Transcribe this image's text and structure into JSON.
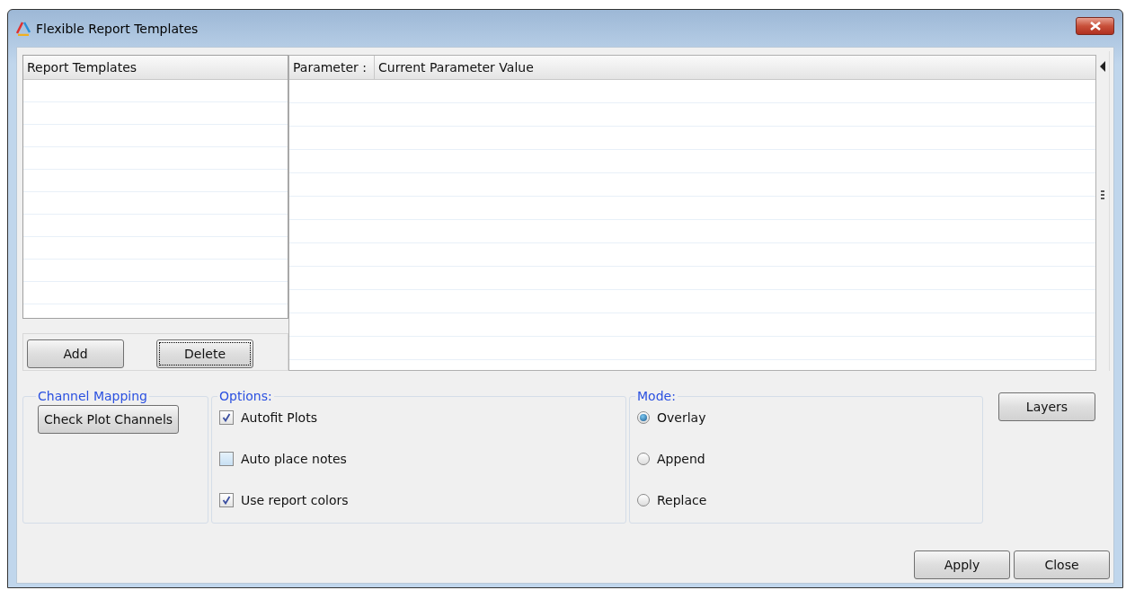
{
  "window": {
    "title": "Flexible Report Templates"
  },
  "templates_list": {
    "header": "Report Templates"
  },
  "template_buttons": [
    {
      "label": "Add",
      "focused": false
    },
    {
      "label": "Delete",
      "focused": true
    }
  ],
  "parameter_table": {
    "columns": [
      "Parameter :",
      "Current Parameter Value"
    ]
  },
  "channel_mapping": {
    "title": "Channel Mapping",
    "button": "Check Plot Channels"
  },
  "options": {
    "title": "Options:",
    "items": [
      {
        "label": "Autofit Plots",
        "checked": true
      },
      {
        "label": "Auto place notes",
        "checked": false
      },
      {
        "label": "Use report colors",
        "checked": true
      }
    ]
  },
  "mode": {
    "title": "Mode:",
    "items": [
      {
        "label": "Overlay",
        "selected": true
      },
      {
        "label": "Append",
        "selected": false
      },
      {
        "label": "Replace",
        "selected": false
      }
    ]
  },
  "layers_button": "Layers",
  "footer_buttons": [
    "Apply",
    "Close"
  ]
}
